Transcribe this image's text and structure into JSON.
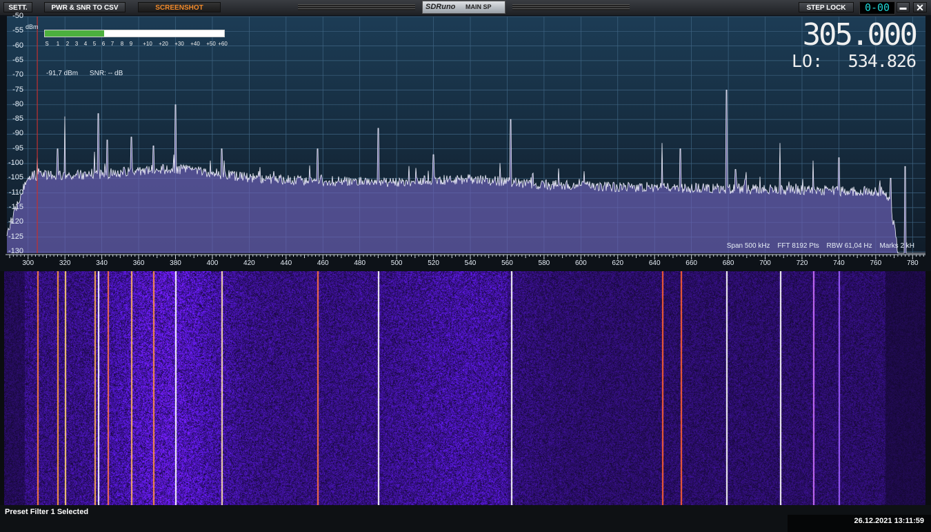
{
  "titlebar": {
    "settings_label": "SETT.",
    "csv_label": "PWR & SNR TO CSV",
    "screenshot_label": "SCREENSHOT",
    "brand": "SDRuno",
    "window_name": "MAIN SP",
    "step_lock_label": "STEP LOCK",
    "step_display": "0-00",
    "minimize_label": "▬",
    "close_label": "✕"
  },
  "spectrum": {
    "unit": "dBm",
    "y_ticks": [
      "-50",
      "-55",
      "-60",
      "-65",
      "-70",
      "-75",
      "-80",
      "-85",
      "-90",
      "-95",
      "-100",
      "-105",
      "-110",
      "-115",
      "-120",
      "-125",
      "-130"
    ],
    "x_ticks": [
      "300",
      "320",
      "340",
      "360",
      "380",
      "400",
      "420",
      "440",
      "460",
      "480",
      "500",
      "520",
      "540",
      "560",
      "580",
      "600",
      "620",
      "640",
      "660",
      "680",
      "700",
      "720",
      "740",
      "760",
      "780"
    ],
    "signal_level": "-91,7 dBm",
    "snr": "SNR: -- dB",
    "frequency": "305.000",
    "lo_label": "LO:",
    "lo_value": "534.826",
    "span": "Span 500 kHz",
    "fft": "FFT 8192 Pts",
    "rbw": "RBW 61,04 Hz",
    "marks": "Marks 2 kH",
    "colors": {
      "trace": "#f4f4ff",
      "fill": "#6a5fb4",
      "marker": "#c23030"
    }
  },
  "smeter": {
    "scale": [
      "S",
      "1",
      "2",
      "3",
      "4",
      "5",
      "6",
      "7",
      "8",
      "9",
      "+10",
      "+20",
      "+30",
      "+40",
      "+50",
      "+60"
    ],
    "level_fraction": 0.33
  },
  "status": {
    "message": "Preset Filter 1 Selected",
    "datetime": "26.12.2021 13:11:59"
  }
}
